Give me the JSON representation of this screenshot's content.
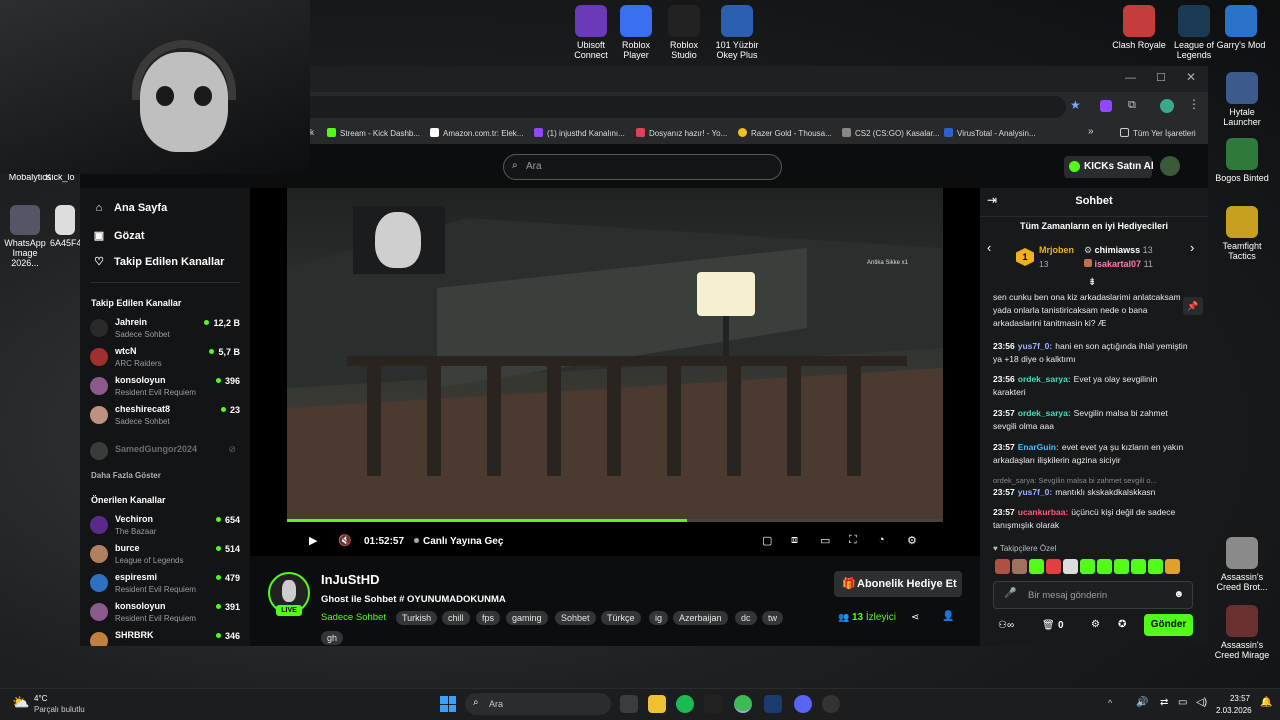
{
  "desktop": {
    "top_icons": [
      {
        "label": "Ubisoft Connect",
        "color": "#6a3ab8"
      },
      {
        "label": "Roblox Player",
        "color": "#3a6ff0"
      },
      {
        "label": "Roblox Studio",
        "color": "#222222"
      },
      {
        "label": "101 Yüzbir Okey Plus",
        "color": "#2b5fb0"
      }
    ],
    "right_icons": [
      {
        "label": "Clash Royale",
        "color": "#c43c3c"
      },
      {
        "label": "League of Legends",
        "color": "#1b3b55"
      },
      {
        "label": "Garry's Mod",
        "color": "#2b73c8"
      }
    ],
    "right_column": [
      {
        "label": "Hytale Launcher",
        "color": "#3c5a8c"
      },
      {
        "label": "Bogos Binted",
        "color": "#2f7a3a"
      },
      {
        "label": "Teamfight Tactics",
        "color": "#c8a020"
      },
      {
        "label": "Assassin's Creed Brot...",
        "color": "#8a8a8a"
      },
      {
        "label": "Assassin's Creed Mirage",
        "color": "#6a3030"
      }
    ],
    "left_column": [
      {
        "label": "Mobalytics"
      },
      {
        "label": "Kick_lo"
      },
      {
        "label": "WhatsApp Image 2026..."
      },
      {
        "label": "6A45F4..."
      }
    ]
  },
  "browser": {
    "bookmarks": [
      {
        "label": "k"
      },
      {
        "label": "Stream - Kick Dashb...",
        "color": "#53fc18"
      },
      {
        "label": "Amazon.com.tr: Elek...",
        "color": "#ffffff"
      },
      {
        "label": "(1) injusthd Kanalını...",
        "color": "#9146ff"
      },
      {
        "label": "Dosyanız hazır! - Yo...",
        "color": "#e0405a"
      },
      {
        "label": "Razer Gold - Thousa...",
        "color": "#f0c020"
      },
      {
        "label": "CS2 (CS:GO) Kasalar...",
        "color": "#888888"
      },
      {
        "label": "VirusTotal - Analysin...",
        "color": "#3060d0"
      }
    ],
    "more": "»",
    "all_bookmarks": "Tüm Yer İşaretleri"
  },
  "kick": {
    "search_placeholder": "Ara",
    "buy_kicks": "KICKs Satın Al",
    "nav": [
      {
        "label": "Ana Sayfa",
        "icon": "home-icon"
      },
      {
        "label": "Gözat",
        "icon": "browse-icon"
      },
      {
        "label": "Takip Edilen Kanallar",
        "icon": "heart-icon"
      }
    ],
    "followed_title": "Takip Edilen Kanallar",
    "followed": [
      {
        "name": "Jahrein",
        "game": "Sadece Sohbet",
        "viewers": "12,2 B",
        "color": "#2a2a2a"
      },
      {
        "name": "wtcN",
        "game": "ARC Raiders",
        "viewers": "5,7 B",
        "color": "#a03030"
      },
      {
        "name": "konsoloyun",
        "game": "Resident Evil Requiem",
        "viewers": "396",
        "color": "#8a5a8a"
      },
      {
        "name": "cheshirecat8",
        "game": "Sadece Sohbet",
        "viewers": "23",
        "color": "#c09080"
      }
    ],
    "offline": "SamedGungor2024",
    "show_more": "Daha Fazla Göster",
    "recommended_title": "Önerilen Kanallar",
    "recommended": [
      {
        "name": "Vechiron",
        "game": "The Bazaar",
        "viewers": "654",
        "color": "#5a2a8a"
      },
      {
        "name": "burce",
        "game": "League of Legends",
        "viewers": "514",
        "color": "#b08060"
      },
      {
        "name": "espiresmi",
        "game": "Resident Evil Requiem",
        "viewers": "479",
        "color": "#3070c0"
      },
      {
        "name": "konsoloyun",
        "game": "Resident Evil Requiem",
        "viewers": "391",
        "color": "#8a5a8a"
      },
      {
        "name": "SHRBRK",
        "game": "",
        "viewers": "346",
        "color": "#c08040"
      }
    ],
    "player": {
      "time": "01:52:57",
      "live_jump": "Canlı Yayına Geç",
      "overlay_label": "Antika Sikke x1",
      "progress": 0.61
    },
    "streamer": {
      "name": "InJuStHD",
      "title": "Ghost ile Sohbet",
      "hashtag": "# OYUNUMADOKUNMA",
      "category": "Sadece Sohbet",
      "live_badge": "LIVE",
      "tags": [
        "Turkish",
        "chill",
        "fps",
        "gaming",
        "Sohbet",
        "Türkçe",
        "ig",
        "Azerbaijan",
        "dc",
        "tw",
        "gh"
      ],
      "gift_button": "Abonelik Hediye Et",
      "viewers": "13",
      "viewers_label": "İzleyici"
    },
    "chat": {
      "title": "Sohbet",
      "top_gifters_title": "Tüm Zamanların en iyi Hediyecileri",
      "gifters": [
        {
          "rank": "1",
          "name": "Mrjoben",
          "count": "13"
        },
        {
          "name": "chimiawss",
          "count": "13"
        },
        {
          "name": "isakartal07",
          "count": "11"
        }
      ],
      "messages": [
        {
          "time": "",
          "user": "",
          "text": "sen cunku ben ona kiz arkadaslarimi anlatcaksam yada onlarla tanistiricaksam nede o bana arkadaslarini tanitmasin ki? Æ",
          "color": "#ffffff"
        },
        {
          "time": "23:56",
          "user": "yus7f_0:",
          "text": "hani en son açtığında ihlal yemiştin ya +18 diye o kalktımı",
          "color": "#9bb0ff"
        },
        {
          "time": "23:56",
          "user": "ordek_sarya:",
          "text": "Evet ya olay sevgilinin karakteri",
          "color": "#3fe0c0"
        },
        {
          "time": "23:57",
          "user": "ordek_sarya:",
          "text": "Sevgilin malsa bi zahmet sevgili olma aaa",
          "color": "#3fe0c0"
        },
        {
          "time": "23:57",
          "user": "EnarGuin:",
          "text": "evet evet ya şu kızların en yakın arkadaşları ilişkilerin agzina siciyir",
          "color": "#40c0ff"
        },
        {
          "time": "",
          "user": "",
          "text": "ordek_sarya: Sevgilin malsa bi zahmet sevgili o...",
          "color": "#888888"
        },
        {
          "time": "23:57",
          "user": "yus7f_0:",
          "text": "mantıklı skskakdkalskkasn",
          "color": "#9bb0ff"
        },
        {
          "time": "23:57",
          "user": "ucankurbaa:",
          "text": "üçüncü kişi değil de sadece tanışmışlık olarak",
          "color": "#ff5a7a"
        }
      ],
      "emote_header": "Takipçilere Özel",
      "input_placeholder": "Bir mesaj gönderin",
      "points": "0",
      "send": "Gönder"
    }
  },
  "taskbar": {
    "weather_temp": "4°C",
    "weather_text": "Parçalı bulutlu",
    "search": "Ara",
    "time": "23:57",
    "date": "2.03.2026"
  }
}
